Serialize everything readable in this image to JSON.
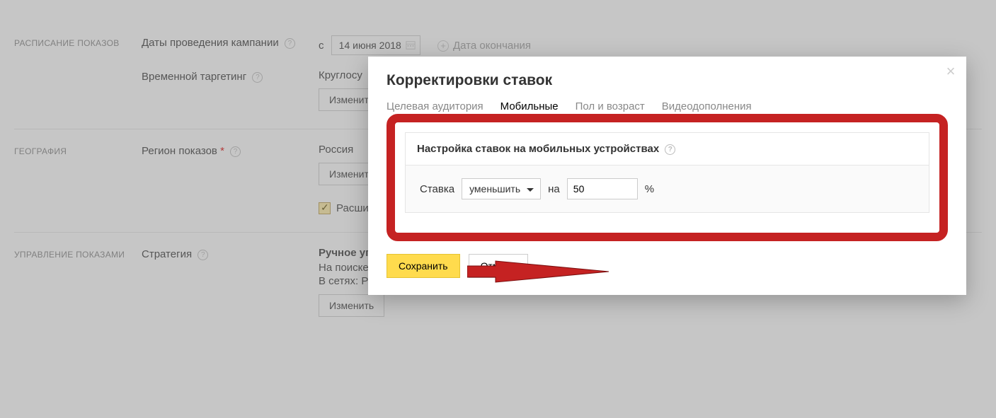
{
  "sections": {
    "schedule": {
      "title": "РАСПИСАНИЕ ПОКАЗОВ",
      "dates_label": "Даты проведения кампании",
      "from_prefix": "с",
      "start_date": "14 июня 2018",
      "end_date_link": "Дата окончания",
      "timetargeting_label": "Временной таргетинг",
      "timetargeting_value": "Круглосу",
      "change_btn": "Изменить"
    },
    "geo": {
      "title": "ГЕОГРАФИЯ",
      "region_label": "Регион показов",
      "region_value": "Россия",
      "change_btn": "Изменить",
      "ext_geo": "Расширенный географический таргетинг"
    },
    "manage": {
      "title": "УПРАВЛЕНИЕ ПОКАЗАМИ",
      "strategy_label": "Стратегия",
      "line1": "Ручное управление ставками с оптимизацией",
      "line2": "На поиске: Показы запрещены",
      "line3": "В сетях: Ручное управление ставками с оптимизацией",
      "change_btn": "Изменить"
    }
  },
  "modal": {
    "title": "Корректировки ставок",
    "tabs": {
      "audience": "Целевая аудитория",
      "mobile": "Мобильные",
      "gender": "Пол и возраст",
      "video": "Видеодополнения"
    },
    "panel_title": "Настройка ставок на мобильных устройствах",
    "bid_label": "Ставка",
    "bid_action": "уменьшить",
    "on_label": "на",
    "bid_value": "50",
    "percent": "%",
    "save": "Сохранить",
    "cancel": "Отмена"
  }
}
